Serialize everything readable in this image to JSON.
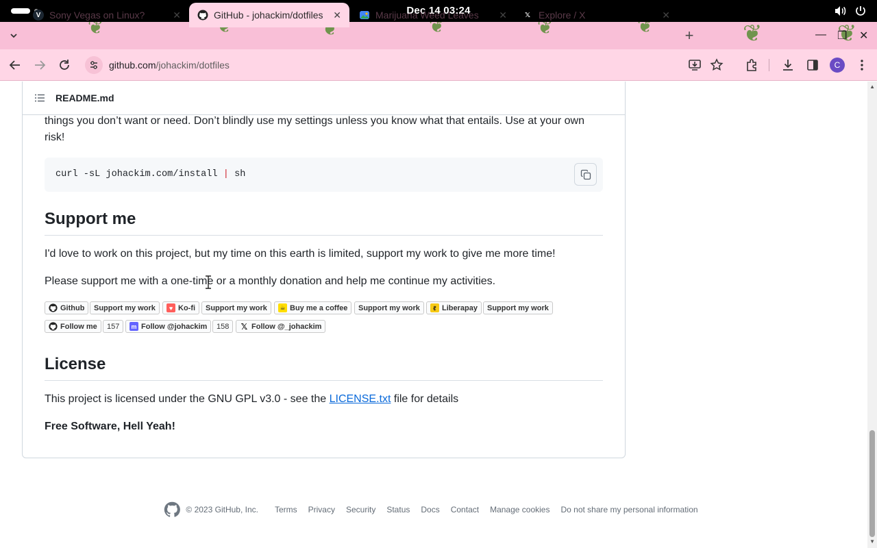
{
  "system": {
    "clock": "Dec 14  03:24"
  },
  "browser": {
    "tabs": [
      {
        "title": "Sony Vegas on Linux?",
        "favicon": "V"
      },
      {
        "title": "GitHub - johackim/dotfiles"
      },
      {
        "title": "Marijuana Weed Leaves"
      },
      {
        "title": "Explore / X"
      }
    ],
    "url_host": "github.com",
    "url_path": "/johackim/dotfiles",
    "profile_initial": "C"
  },
  "readme": {
    "file_name": "README.md",
    "intro_text": "things you don’t want or need. Don’t blindly use my settings unless you know what that entails. Use at your own risk!",
    "install_cmd_pre": "curl -sL johackim.com/install ",
    "install_cmd_pipe": "|",
    "install_cmd_post": " sh",
    "support": {
      "heading": "Support me",
      "p1": "I'd love to work on this project, but my time on this earth is limited, support my work to give me more time!",
      "p2": "Please support me with a one-time or a monthly donation and help me continue my activities.",
      "badges_row1": [
        "Github",
        "Support my work",
        "Ko-fi",
        "Support my work",
        "Buy me a coffee",
        "Support my work",
        "Liberapay",
        "Support my work"
      ],
      "badges_row2": [
        "Follow me",
        "157",
        "Follow @johackim",
        "158",
        "Follow @_johackim"
      ]
    },
    "license": {
      "heading": "License",
      "text_before": "This project is licensed under the GNU GPL v3.0 - see the ",
      "link": "LICENSE.txt",
      "text_after": " file for details",
      "tagline": "Free Software, Hell Yeah!"
    }
  },
  "footer": {
    "copyright": "© 2023 GitHub, Inc.",
    "links": [
      "Terms",
      "Privacy",
      "Security",
      "Status",
      "Docs",
      "Contact",
      "Manage cookies",
      "Do not share my personal information"
    ]
  },
  "colors": {
    "tabstrip": "#f9bfd7",
    "toolbar": "#ffd6e6",
    "link": "#0969da"
  }
}
